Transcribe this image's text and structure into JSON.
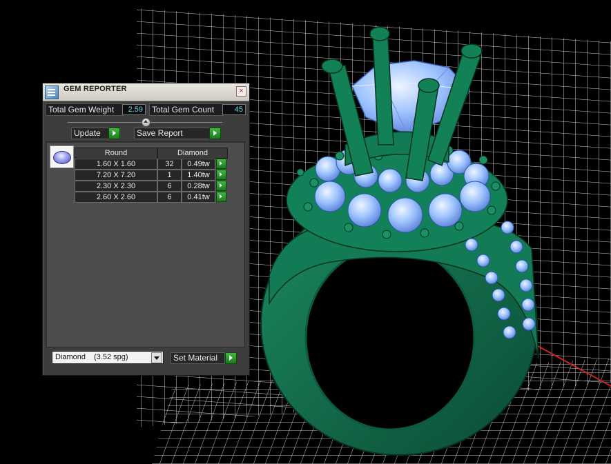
{
  "window": {
    "title": "GEM REPORTER",
    "icons": {
      "app": "gem-reporter-app-icon",
      "close": "close-icon"
    },
    "close_glyph": "×"
  },
  "summary": {
    "weight_label": "Total Gem Weight",
    "weight_value": "2.59",
    "count_label": "Total Gem Count",
    "count_value": "45"
  },
  "buttons": {
    "update": "Update",
    "save_report": "Save Report",
    "set_material": "Set Material"
  },
  "table": {
    "headers": [
      "Round",
      "Diamond"
    ],
    "rows": [
      {
        "size": "1.60 X 1.60",
        "count": "32",
        "weight": "0.49tw"
      },
      {
        "size": "7.20 X 7.20",
        "count": "1",
        "weight": "1.40tw"
      },
      {
        "size": "2.30 X 2.30",
        "count": "6",
        "weight": "0.28tw"
      },
      {
        "size": "2.60 X 2.60",
        "count": "6",
        "weight": "0.41tw"
      }
    ]
  },
  "material": {
    "selected_name": "Diamond",
    "selected_spg": "(3.52 spg)"
  },
  "colors": {
    "metal_green": "#0f6b4a",
    "gem_blue": "#9fc4ff",
    "grid": "#d0d0d0",
    "value_text": "#6ecfe8",
    "accent_go": "#2ea82e"
  }
}
